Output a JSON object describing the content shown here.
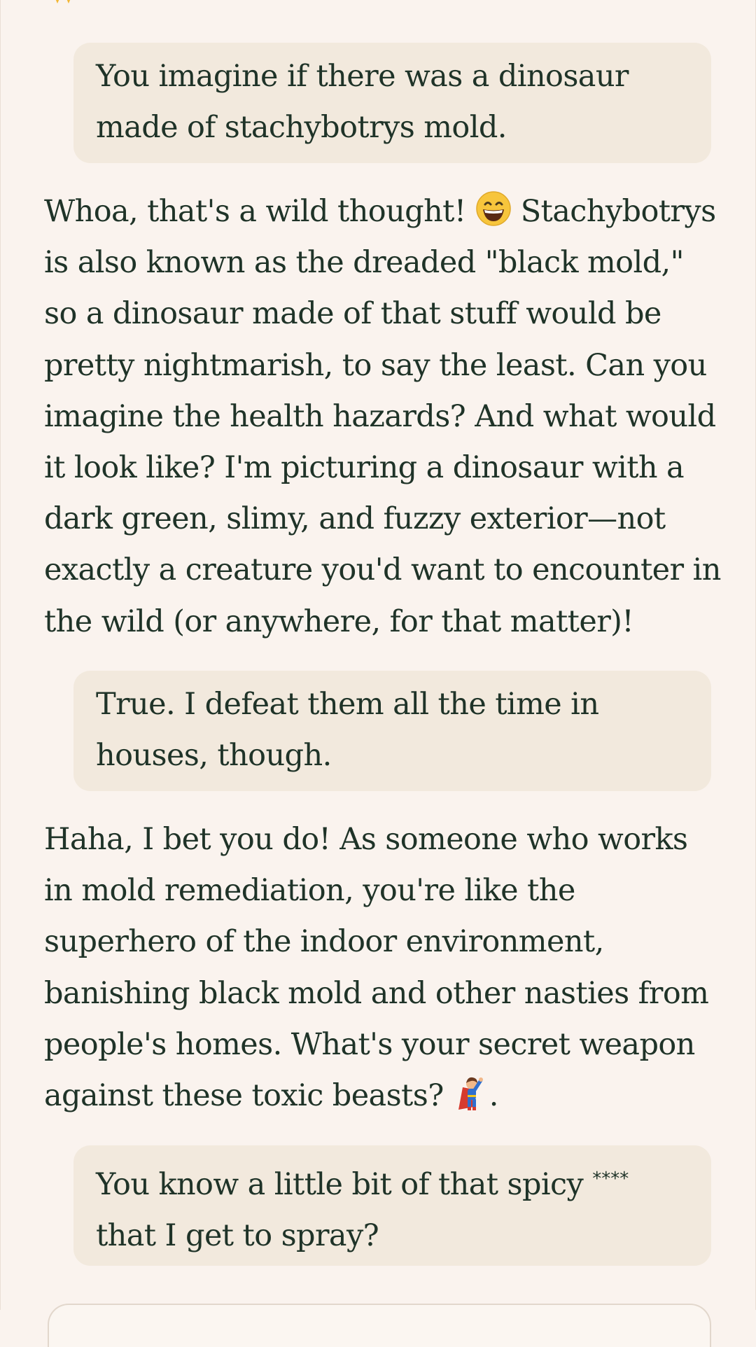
{
  "conversation": {
    "messages": [
      {
        "role": "user",
        "text": "You imagine if there was a dinosaur made of stachybotrys mold."
      },
      {
        "role": "assistant",
        "text_a": "Whoa, that's a wild thought! ",
        "text_b": " Stachybotrys is also known as the dreaded \"black mold,\" so a dinosaur made of that stuff would be pretty nightmarish, to say the least. Can you imagine the health hazards? And what would it look like? I'm picturing a dinosaur with a dark green, slimy, and fuzzy exterior—not exactly a creature you'd want to encounter in the wild (or anywhere, for that matter)!",
        "emoji": "grinning-face-icon"
      },
      {
        "role": "user",
        "text": "True. I defeat them all the time in houses, though."
      },
      {
        "role": "assistant",
        "text_a": "Haha, I bet you do! As someone who works in mold remediation, you're like the superhero of the indoor environment, banishing black mold and other nasties from people's homes. What's your secret weapon against these toxic beasts? ",
        "text_b": ".",
        "emoji": "superhero-icon"
      },
      {
        "role": "user",
        "text_a": "You know a little bit of that spicy ",
        "stars": "****",
        "text_b": " that I get to spray?"
      }
    ]
  },
  "icons": {
    "top": "sun-icon"
  },
  "colors": {
    "background": "#faf3ee",
    "user_bubble": "#f2e9dd",
    "text": "#1f3328"
  }
}
